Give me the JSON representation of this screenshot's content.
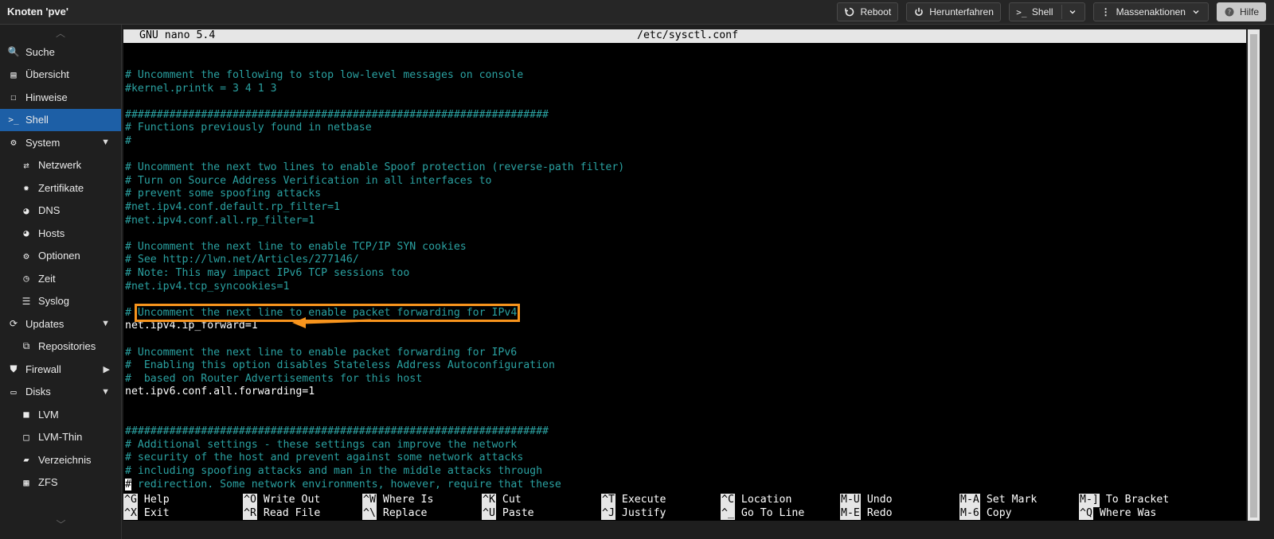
{
  "window": {
    "title": "Knoten 'pve'"
  },
  "toolbar": {
    "reboot": "Reboot",
    "shutdown": "Herunterfahren",
    "shell": "Shell",
    "bulk": "Massenaktionen",
    "help": "Hilfe"
  },
  "sidebar": {
    "items": [
      {
        "label": "Suche",
        "icon": "search-icon"
      },
      {
        "label": "Übersicht",
        "icon": "book-icon"
      },
      {
        "label": "Hinweise",
        "icon": "note-icon"
      },
      {
        "label": "Shell",
        "icon": "terminal-icon",
        "active": true
      },
      {
        "label": "System",
        "icon": "gears-icon",
        "expandable": true
      },
      {
        "label": "Netzwerk",
        "icon": "exchange-icon"
      },
      {
        "label": "Zertifikate",
        "icon": "certificate-icon"
      },
      {
        "label": "DNS",
        "icon": "globe-icon"
      },
      {
        "label": "Hosts",
        "icon": "globe-icon"
      },
      {
        "label": "Optionen",
        "icon": "gear-icon"
      },
      {
        "label": "Zeit",
        "icon": "clock-icon"
      },
      {
        "label": "Syslog",
        "icon": "list-icon"
      },
      {
        "label": "Updates",
        "icon": "refresh-icon",
        "expandable": true
      },
      {
        "label": "Repositories",
        "icon": "repo-icon"
      },
      {
        "label": "Firewall",
        "icon": "shield-icon",
        "expandable": true
      },
      {
        "label": "Disks",
        "icon": "hdd-icon",
        "expandable": true
      },
      {
        "label": "LVM",
        "icon": "square-icon"
      },
      {
        "label": "LVM-Thin",
        "icon": "square-outline-icon"
      },
      {
        "label": "Verzeichnis",
        "icon": "folder-icon"
      },
      {
        "label": "ZFS",
        "icon": "grid-icon"
      }
    ]
  },
  "nano": {
    "version": "GNU nano 5.4",
    "file": "/etc/sysctl.conf",
    "lines": [
      {
        "t": "",
        "c": "comment"
      },
      {
        "t": "# Uncomment the following to stop low-level messages on console",
        "c": "comment"
      },
      {
        "t": "#kernel.printk = 3 4 1 3",
        "c": "comment"
      },
      {
        "t": "",
        "c": "comment"
      },
      {
        "t": "###################################################################",
        "c": "comment"
      },
      {
        "t": "# Functions previously found in netbase",
        "c": "comment"
      },
      {
        "t": "#",
        "c": "comment"
      },
      {
        "t": "",
        "c": "comment"
      },
      {
        "t": "# Uncomment the next two lines to enable Spoof protection (reverse-path filter)",
        "c": "comment"
      },
      {
        "t": "# Turn on Source Address Verification in all interfaces to",
        "c": "comment"
      },
      {
        "t": "# prevent some spoofing attacks",
        "c": "comment"
      },
      {
        "t": "#net.ipv4.conf.default.rp_filter=1",
        "c": "comment"
      },
      {
        "t": "#net.ipv4.conf.all.rp_filter=1",
        "c": "comment"
      },
      {
        "t": "",
        "c": "comment"
      },
      {
        "t": "# Uncomment the next line to enable TCP/IP SYN cookies",
        "c": "comment"
      },
      {
        "t": "# See http://lwn.net/Articles/277146/",
        "c": "comment"
      },
      {
        "t": "# Note: This may impact IPv6 TCP sessions too",
        "c": "comment"
      },
      {
        "t": "#net.ipv4.tcp_syncookies=1",
        "c": "comment"
      },
      {
        "t": "",
        "c": "comment"
      },
      {
        "t": "# Uncomment the next line to enable packet forwarding for IPv4",
        "c": "comment",
        "highlight": true
      },
      {
        "t": "net.ipv4.ip_forward=1",
        "c": "plain"
      },
      {
        "t": "",
        "c": "comment"
      },
      {
        "t": "# Uncomment the next line to enable packet forwarding for IPv6",
        "c": "comment"
      },
      {
        "t": "#  Enabling this option disables Stateless Address Autoconfiguration",
        "c": "comment"
      },
      {
        "t": "#  based on Router Advertisements for this host",
        "c": "comment"
      },
      {
        "t": "net.ipv6.conf.all.forwarding=1",
        "c": "plain"
      },
      {
        "t": "",
        "c": "comment"
      },
      {
        "t": "",
        "c": "comment"
      },
      {
        "t": "###################################################################",
        "c": "comment"
      },
      {
        "t": "# Additional settings - these settings can improve the network",
        "c": "comment"
      },
      {
        "t": "# security of the host and prevent against some network attacks",
        "c": "comment"
      },
      {
        "t": "# including spoofing attacks and man in the middle attacks through",
        "c": "comment"
      },
      {
        "t": "# redirection. Some network environments, however, require that these",
        "c": "comment",
        "cursor": true
      }
    ],
    "help": [
      [
        {
          "k": "^G",
          "l": "Help"
        },
        {
          "k": "^O",
          "l": "Write Out"
        },
        {
          "k": "^W",
          "l": "Where Is"
        },
        {
          "k": "^K",
          "l": "Cut"
        },
        {
          "k": "^T",
          "l": "Execute"
        },
        {
          "k": "^C",
          "l": "Location"
        },
        {
          "k": "M-U",
          "l": "Undo"
        },
        {
          "k": "M-A",
          "l": "Set Mark"
        },
        {
          "k": "M-]",
          "l": "To Bracket"
        }
      ],
      [
        {
          "k": "^X",
          "l": "Exit"
        },
        {
          "k": "^R",
          "l": "Read File"
        },
        {
          "k": "^\\",
          "l": "Replace"
        },
        {
          "k": "^U",
          "l": "Paste"
        },
        {
          "k": "^J",
          "l": "Justify"
        },
        {
          "k": "^_",
          "l": "Go To Line"
        },
        {
          "k": "M-E",
          "l": "Redo"
        },
        {
          "k": "M-6",
          "l": "Copy"
        },
        {
          "k": "^Q",
          "l": "Where Was"
        }
      ]
    ]
  },
  "colors": {
    "accent": "#1d5fa6",
    "annotation": "#f7941d",
    "comment": "#2aa1a1"
  }
}
